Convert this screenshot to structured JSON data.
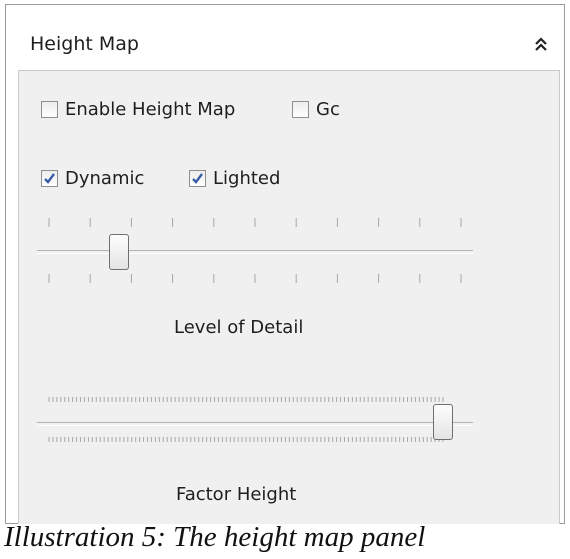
{
  "panel": {
    "title": "Height Map",
    "collapse_icon": "double-chevron-up-icon"
  },
  "checkboxes": {
    "enable_height_map": {
      "label": "Enable Height Map",
      "checked": false
    },
    "gc": {
      "label": "Gc",
      "checked": false
    },
    "dynamic": {
      "label": "Dynamic",
      "checked": true
    },
    "lighted": {
      "label": "Lighted",
      "checked": true
    }
  },
  "sliders": {
    "level_of_detail": {
      "label": "Level of Detail",
      "value_fraction": 0.17
    },
    "factor_height": {
      "label": "Factor Height",
      "value_fraction": 1.0
    }
  },
  "caption": "Illustration 5: The height map panel",
  "colors": {
    "check_mark": "#3a5da6",
    "panel_bg": "#f0f0f0"
  }
}
